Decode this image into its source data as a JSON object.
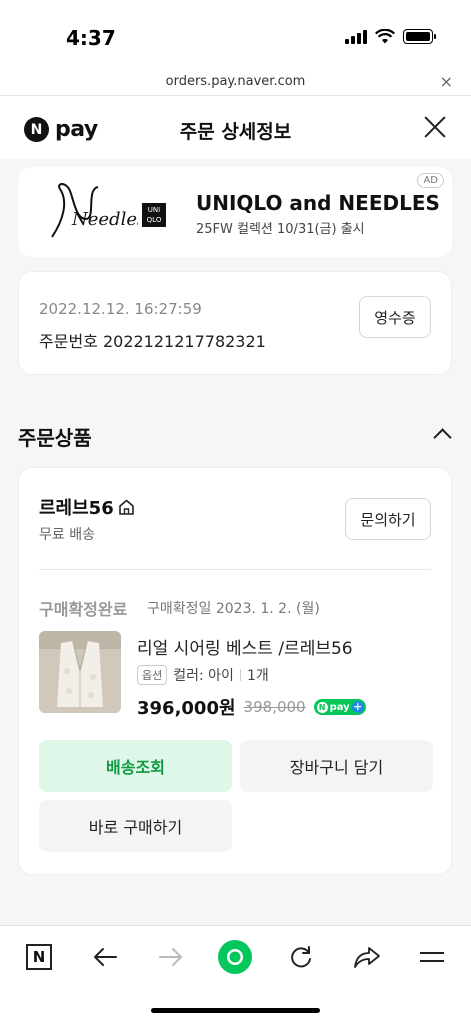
{
  "status": {
    "time": "4:37"
  },
  "browser": {
    "url": "orders.pay.naver.com",
    "close_glyph": "×"
  },
  "header": {
    "logo_letter": "N",
    "logo_text": "pay",
    "title": "주문 상세정보"
  },
  "ad": {
    "brand_script": "Needles",
    "uniqlo_top": "UNI",
    "uniqlo_bottom": "QLO",
    "title": "UNIQLO and NEEDLES",
    "subtitle": "25FW 컬렉션 10/31(금) 출시",
    "badge": "AD"
  },
  "order": {
    "datetime": "2022.12.12. 16:27:59",
    "number": "주문번호 2022121217782321",
    "receipt_label": "영수증"
  },
  "section": {
    "title": "주문상품"
  },
  "product": {
    "store": "르레브56",
    "shipping": "무료 배송",
    "ask_label": "문의하기",
    "status": "구매확정완료",
    "status_date": "구매확정일 2023. 1. 2. (월)",
    "name": "리얼 시어링 베스트 /르레브56",
    "option_tag": "옵션",
    "option_value": "컬러: 아이",
    "quantity": "1개",
    "price": "396,000원",
    "original_price": "398,000",
    "npay_badge": "pay",
    "npay_plus": "+"
  },
  "actions": {
    "track": "배송조회",
    "cart": "장바구니 담기",
    "buy_again": "바로 구매하기"
  },
  "toolbar": {
    "home_letter": "N"
  },
  "colors": {
    "naver_green": "#03c75a",
    "track_text": "#0e9a3f",
    "track_bg": "#dff7e8"
  }
}
